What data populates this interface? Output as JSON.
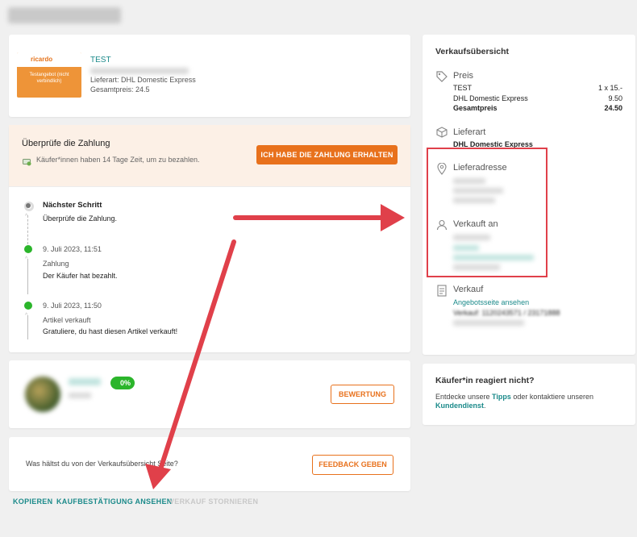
{
  "product": {
    "name": "TEST",
    "logo_text": "ricardo",
    "image_text": "Testangebot (nicht verbindlich)",
    "delivery": "Lieferart: DHL Domestic Express",
    "total": "Gesamtpreis: 24.5"
  },
  "payment": {
    "title": "Überprüfe die Zahlung",
    "note": "Käufer*innen haben 14 Tage Zeit, um zu bezahlen.",
    "button": "ICH HABE DIE ZAHLUNG ERHALTEN"
  },
  "timeline": [
    {
      "head": "Nächster Schritt",
      "title": "",
      "desc": "Überprüfe die Zahlung."
    },
    {
      "head": "9. Juli 2023, 11:51",
      "title": "Zahlung",
      "desc": "Der Käufer hat bezahlt."
    },
    {
      "head": "9. Juli 2023, 11:50",
      "title": "Artikel verkauft",
      "desc": "Gratuliere, du hast diesen Artikel verkauft!"
    }
  ],
  "rating": {
    "badge": "0%",
    "button": "BEWERTUNG"
  },
  "feedback": {
    "question": "Was hältst du von der Verkaufsübersicht Seite?",
    "button": "FEEDBACK GEBEN"
  },
  "bottom_links": {
    "copy": "KOPIEREN",
    "confirm": "KAUFBESTÄTIGUNG ANSEHEN",
    "cancel": "VERKAUF STORNIEREN"
  },
  "overview": {
    "title": "Verkaufsübersicht",
    "price_label": "Preis",
    "price_rows": [
      {
        "label": "TEST",
        "value": "1 x 15.-"
      },
      {
        "label": "DHL Domestic Express",
        "value": "9.50"
      },
      {
        "label": "Gesamtpreis",
        "value": "24.50"
      }
    ],
    "delivery_label": "Lieferart",
    "delivery_value": "DHL Domestic Express",
    "address_label": "Lieferadresse",
    "sold_to_label": "Verkauft an",
    "sale_label": "Verkauf",
    "offer_link": "Angebotsseite ansehen",
    "sale_number": "Verkauf: 1120243571 / 23171888"
  },
  "help": {
    "title": "Käufer*in reagiert nicht?",
    "text_before": "Entdecke unsere ",
    "tips": "Tipps",
    "text_middle": " oder kontaktiere unseren",
    "service": "Kundendienst",
    "text_after": "."
  },
  "colors": {
    "accent_orange": "#e8711c",
    "link_teal": "#1b8a8a",
    "success_green": "#2bb52b",
    "annotation_red": "#e0404a"
  }
}
